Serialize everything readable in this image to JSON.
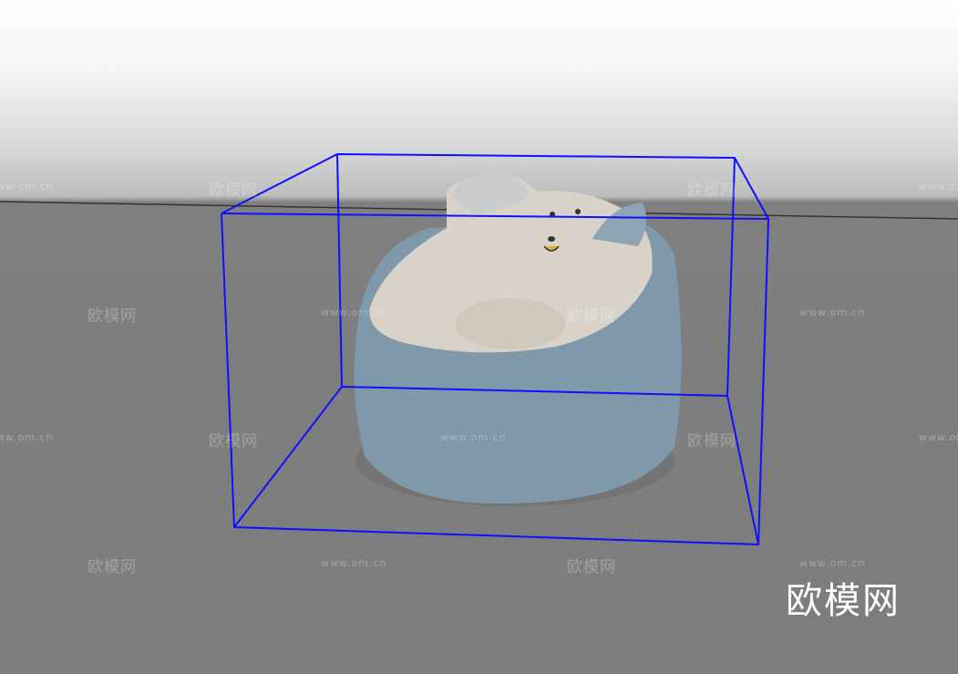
{
  "watermark": {
    "brand": "欧模网",
    "url": "www.om.cn"
  },
  "logo": "欧模网",
  "colors": {
    "bounding_box": "#1010ff",
    "floor": "#7d7d7d",
    "fabric": "#7f98aa",
    "cushion": "#d8d2c8"
  }
}
